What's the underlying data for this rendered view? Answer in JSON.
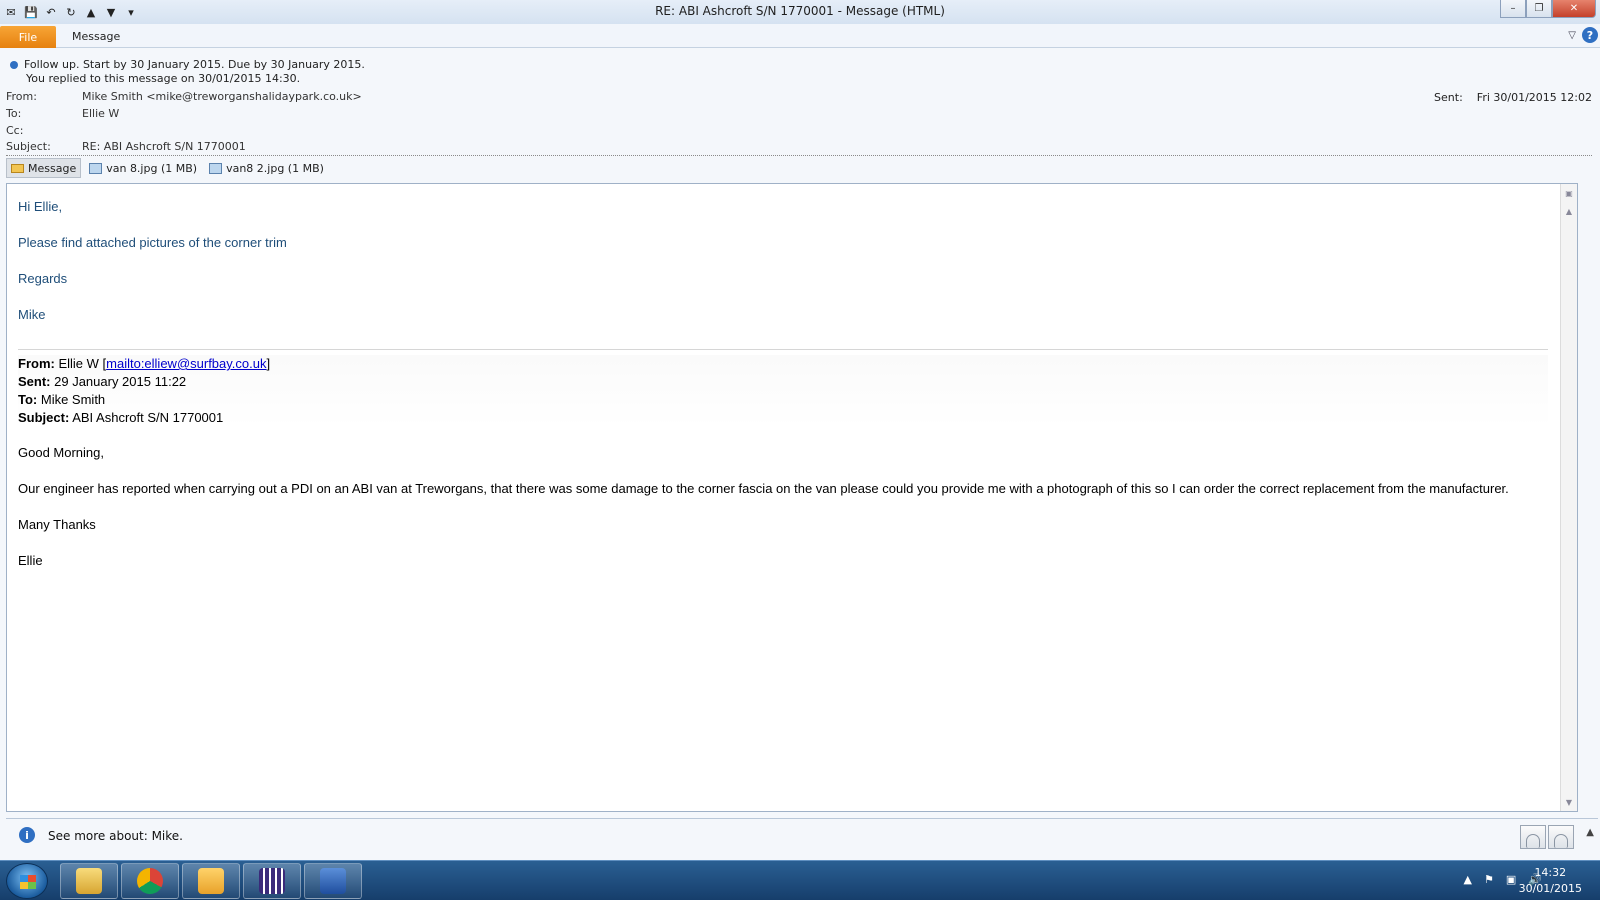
{
  "window": {
    "title": "RE: ABI Ashcroft S/N 1770001  -  Message (HTML)",
    "controls": {
      "minimize": "–",
      "restore": "❐",
      "close": "✕"
    }
  },
  "ribbon": {
    "tabs": [
      {
        "label": "File"
      },
      {
        "label": "Message"
      }
    ]
  },
  "header": {
    "followup_line1": "Follow up.  Start by 30 January 2015.  Due by 30 January 2015.",
    "followup_line2": "You replied to this message on 30/01/2015 14:30.",
    "from_label": "From:",
    "from_value": "Mike Smith <mike@treworganshalidaypark.co.uk>",
    "to_label": "To:",
    "to_value": "Ellie W",
    "cc_label": "Cc:",
    "cc_value": "",
    "subject_label": "Subject:",
    "subject_value": "RE: ABI Ashcroft S/N 1770001",
    "sent_label": "Sent:",
    "sent_value": "Fri 30/01/2015 12:02"
  },
  "attachments": [
    {
      "label": "Message",
      "active": true
    },
    {
      "label": "van 8.jpg (1 MB)"
    },
    {
      "label": "van8 2.jpg (1 MB)"
    }
  ],
  "body": {
    "greeting": "Hi Ellie,",
    "line1": "Please find attached pictures of the corner trim",
    "regards": "Regards",
    "signature": "Mike",
    "quoted": {
      "from_label": "From:",
      "from_name": "Ellie W [",
      "from_link": "mailto:elliew@surfbay.co.uk",
      "from_close": "]",
      "sent_label": "Sent:",
      "sent_value": "29 January 2015 11:22",
      "to_label": "To:",
      "to_value": "Mike Smith",
      "subject_label": "Subject:",
      "subject_value": "ABI Ashcroft S/N 1770001",
      "greeting": "Good Morning,",
      "paragraph": "Our engineer has reported when carrying out a PDI on an ABI van at Treworgans, that there was some damage to the corner fascia on the van please could you provide me with a photograph of this so I can order the correct replacement from the manufacturer.",
      "thanks": "Many Thanks",
      "signature": "Ellie"
    }
  },
  "people_pane": {
    "text": "See more about: Mike."
  },
  "taskbar": {
    "time": "14:32",
    "date": "30/01/2015"
  },
  "colors": {
    "file_tab": "#e6810f",
    "body_text": "#1f4e79",
    "taskbar": "#1f4f80"
  }
}
